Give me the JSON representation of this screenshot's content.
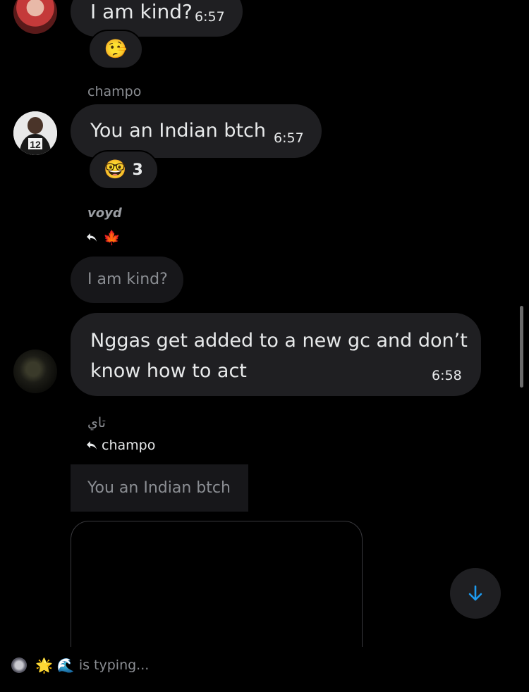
{
  "messages": [
    {
      "text": "I am kind?",
      "time": "6:57",
      "reaction": {
        "icon": "lying-face-emoji"
      }
    },
    {
      "sender": "champo",
      "text": "You an Indian btch",
      "time": "6:57",
      "reaction": {
        "icon": "nerd-face-emoji",
        "count": "3"
      }
    },
    {
      "sender": "voyd",
      "reply_icons": [
        "reply-arrow-icon",
        "maple-leaf-emoji"
      ],
      "quoted_text": "I am kind?",
      "text": "Nggas get added to a new gc and don’t know how to act",
      "time": "6:58"
    },
    {
      "sender": "تاي",
      "reply_to": "champo",
      "quoted_text": "You an Indian btch"
    }
  ],
  "typing": {
    "text": "is typing..."
  },
  "colors": {
    "background": "#000000",
    "bubble": "#1f1f22",
    "accent": "#1d9bf0"
  },
  "icons": {
    "scroll_down": "arrow-down-icon"
  }
}
